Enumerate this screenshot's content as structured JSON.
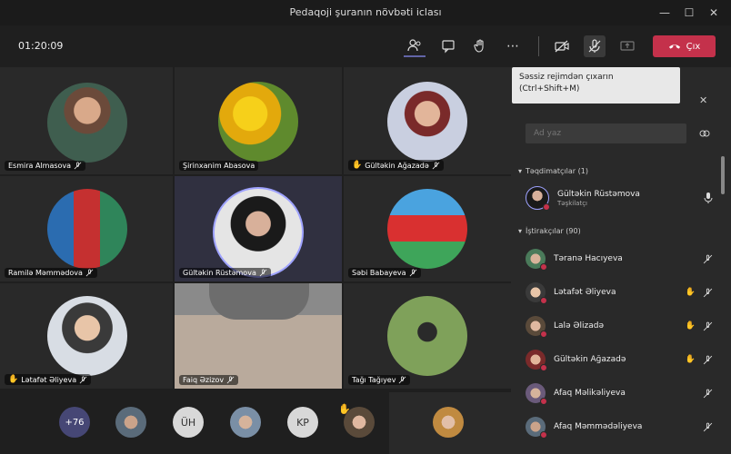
{
  "window": {
    "title": "Pedaqoji şuranın növbəti iclası"
  },
  "toolbar": {
    "timer": "01:20:09",
    "leave_label": "Çıx"
  },
  "tooltip": {
    "line1": "Səssiz rejimdən çıxarın",
    "line2": "(Ctrl+Shift+M)"
  },
  "tiles": [
    {
      "name": "Esmira Almasova",
      "hand": false,
      "mic_off": true
    },
    {
      "name": "Şirinxanim Abasova",
      "hand": false,
      "mic_off": false
    },
    {
      "name": "Gültəkin Ağazadə",
      "hand": true,
      "mic_off": true
    },
    {
      "name": "Ramilə Məmmədova",
      "hand": false,
      "mic_off": true
    },
    {
      "name": "Gültəkin Rüstəmova",
      "hand": false,
      "mic_off": true
    },
    {
      "name": "Səbi Babayeva",
      "hand": false,
      "mic_off": true
    },
    {
      "name": "Lətafət Əliyeva",
      "hand": true,
      "mic_off": true
    },
    {
      "name": "Faiq Əzizov",
      "hand": false,
      "mic_off": true
    },
    {
      "name": "Tağı Tağıyev",
      "hand": false,
      "mic_off": true
    }
  ],
  "bottom_strip": {
    "overflow_label": "+76",
    "initials": [
      "ÜH",
      "KP"
    ]
  },
  "panel": {
    "search_placeholder": "Ad yaz",
    "presenters_header": "Təqdimatçılar (1)",
    "participants_header": "İştirakçılar (90)",
    "presenter": {
      "name": "Gültəkin Rüstəmova",
      "role": "Təşkilatçı"
    },
    "participants": [
      {
        "name": "Təranə Hacıyeva",
        "hand": false
      },
      {
        "name": "Lətafət Əliyeva",
        "hand": true
      },
      {
        "name": "Lalə Əlizadə",
        "hand": true
      },
      {
        "name": "Gültəkin Ağazadə",
        "hand": true
      },
      {
        "name": "Afaq Məlikəliyeva",
        "hand": false
      },
      {
        "name": "Afaq Məmmədəliyeva",
        "hand": false
      }
    ]
  },
  "colors": {
    "accent": "#6264a7",
    "leave": "#c4314b",
    "hand": "#f0b000"
  }
}
